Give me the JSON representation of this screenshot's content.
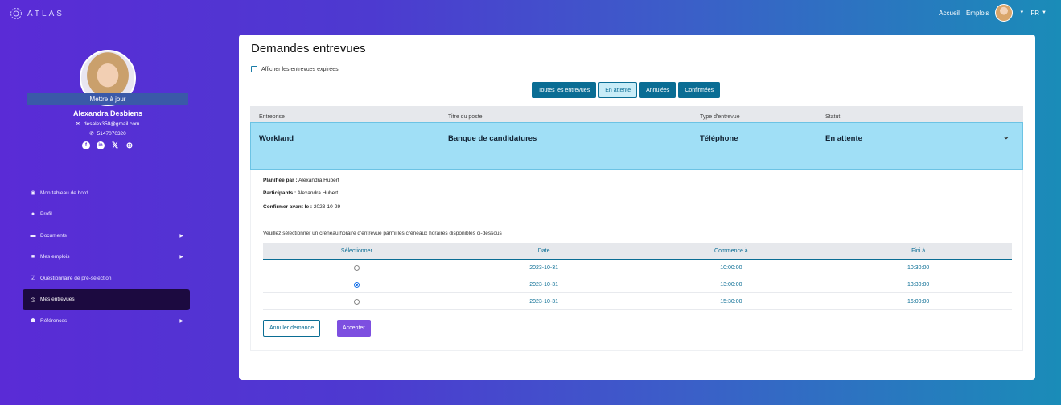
{
  "app": {
    "logo_text": "ATLAS"
  },
  "topnav": {
    "home": "Accueil",
    "jobs": "Emplois",
    "lang": "FR"
  },
  "profile": {
    "update_label": "Mettre à jour",
    "name": "Alexandra  Desbiens",
    "email": "desalex350@gmail.com",
    "phone": "5147070320"
  },
  "sidebar": {
    "items": [
      {
        "label": "Mon tableau de bord",
        "icon": "dashboard-icon",
        "glyph": "◉"
      },
      {
        "label": "Profil",
        "icon": "user-icon",
        "glyph": "●"
      },
      {
        "label": "Documents",
        "icon": "folder-icon",
        "glyph": "▬"
      },
      {
        "label": "Mes emplois",
        "icon": "briefcase-icon",
        "glyph": "■"
      },
      {
        "label": "Questionnaire de pré-sélection",
        "icon": "checkbox-icon",
        "glyph": "☑"
      },
      {
        "label": "Mes entrevues",
        "icon": "clock-icon",
        "glyph": "◷"
      },
      {
        "label": "Références",
        "icon": "users-icon",
        "glyph": "☗"
      }
    ]
  },
  "main": {
    "title": "Demandes entrevues",
    "show_expired_label": "Afficher les entrevues expirées",
    "filters": {
      "all": "Toutes les entrevues",
      "pending": "En attente",
      "cancelled": "Annulées",
      "confirmed": "Confirmées"
    },
    "table": {
      "headers": {
        "company": "Entreprise",
        "title": "Titre du poste",
        "type": "Type d'entrevue",
        "status": "Statut"
      },
      "row": {
        "company": "Workland",
        "title": "Banque de candidatures",
        "type": "Téléphone",
        "status": "En attente"
      }
    },
    "detail": {
      "planned_by_label": "Planifiée par :",
      "planned_by": "Alexandra Hubert",
      "participants_label": "Participants :",
      "participants": "Alexandra Hubert",
      "confirm_before_label": "Confirmer avant le :",
      "confirm_before": "2023-10-29",
      "instructions": "Veuillez sélectionner un créneau horaire d'entrevue parmi les créneaux horaires disponibles ci-dessous",
      "slot_headers": {
        "select": "Sélectionner",
        "date": "Date",
        "start": "Commence à",
        "end": "Fini à"
      },
      "slots": [
        {
          "date": "2023-10-31",
          "start": "10:00:00",
          "end": "10:30:00",
          "selected": false
        },
        {
          "date": "2023-10-31",
          "start": "13:00:00",
          "end": "13:30:00",
          "selected": true
        },
        {
          "date": "2023-10-31",
          "start": "15:30:00",
          "end": "16:00:00",
          "selected": false
        }
      ],
      "cancel_label": "Annuler demande",
      "accept_label": "Accepter"
    }
  }
}
